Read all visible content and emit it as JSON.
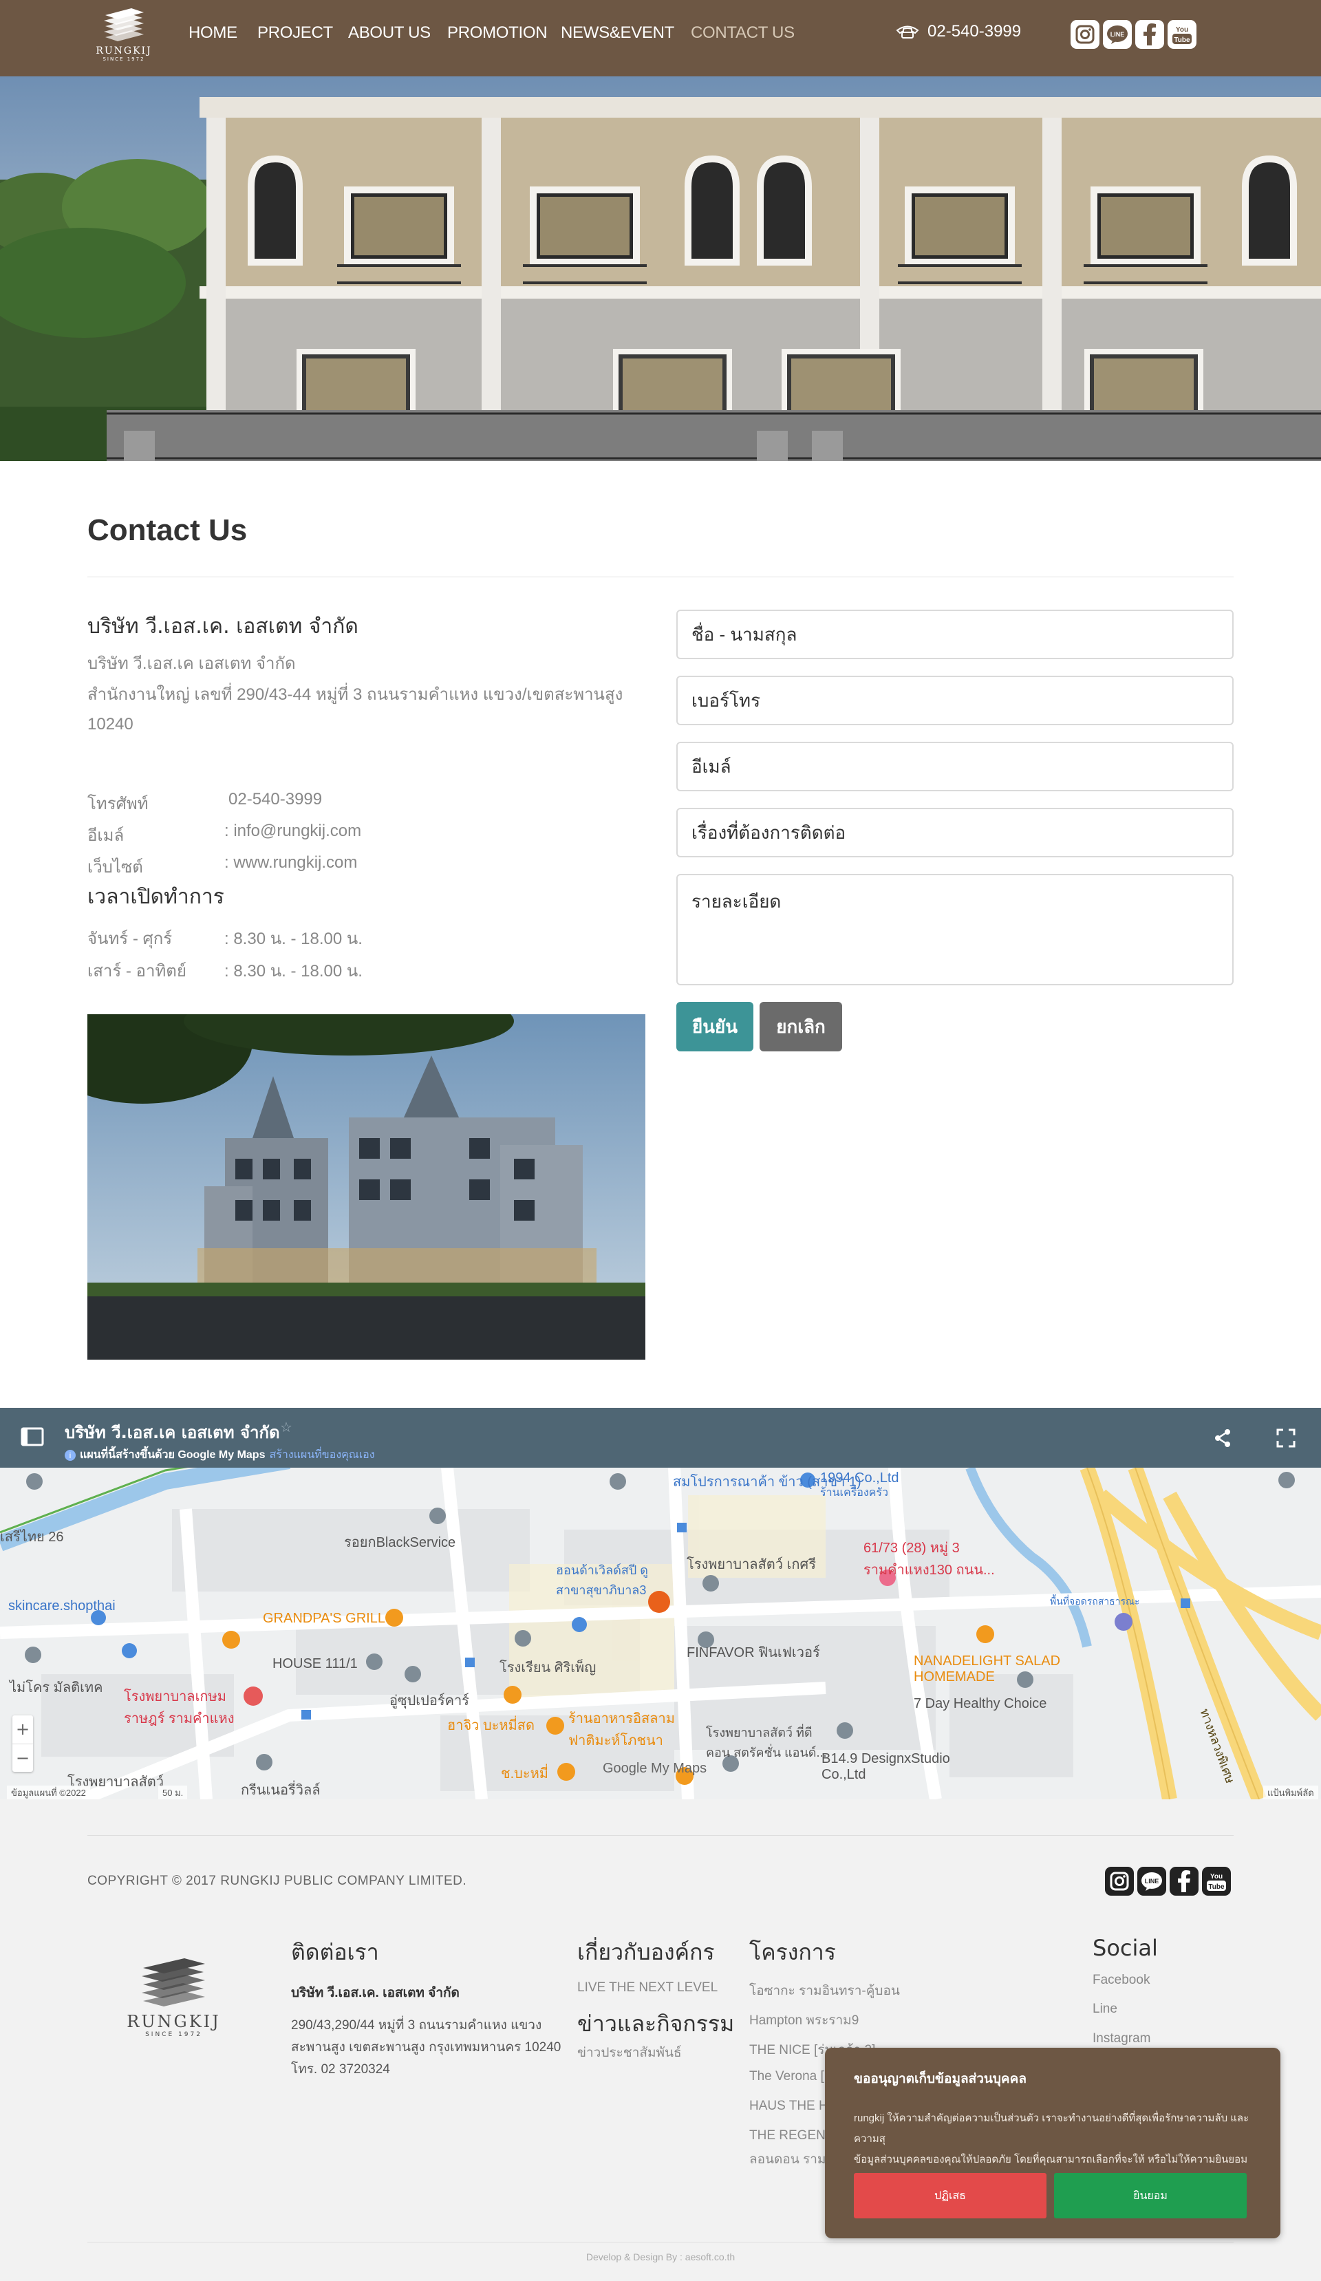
{
  "brand": {
    "name": "RUNGKIJ",
    "since": "SINCE 1972"
  },
  "nav": {
    "items": [
      {
        "label": "HOME"
      },
      {
        "label": "PROJECT"
      },
      {
        "label": "ABOUT US"
      },
      {
        "label": "PROMOTION"
      },
      {
        "label": "NEWS&EVENT"
      },
      {
        "label": "CONTACT US",
        "active": true
      }
    ],
    "phone": "02-540-3999"
  },
  "social": {
    "icons": [
      "instagram-icon",
      "line-icon",
      "facebook-icon",
      "youtube-icon"
    ],
    "youtube_text": "You Tube",
    "line_text": "LINE"
  },
  "contact": {
    "title": "Contact Us",
    "company": "บริษัท วี.เอส.เค. เอสเตท จำกัด",
    "company_sub": "บริษัท วี.เอส.เค เอสเตท จำกัด",
    "address_1": "สำนักงานใหญ่ เลขที่ 290/43-44 หมู่ที่ 3 ถนนรามคำแหง แขวง/เขตสะพานสูง",
    "address_2": "10240",
    "phone_label": "โทรศัพท์",
    "phone_value": "02-540-3999",
    "email_label": "อีเมล์",
    "email_value": ": info@rungkij.com",
    "web_label": "เว็บไซต์",
    "web_value": ": www.rungkij.com",
    "hours_title": "เวลาเปิดทำการ",
    "hours": [
      {
        "day": "จันทร์ - ศุกร์",
        "time": ": 8.30 น. - 18.00 น."
      },
      {
        "day": "เสาร์ - อาทิตย์",
        "time": ": 8.30 น. - 18.00 น."
      }
    ]
  },
  "form": {
    "name_placeholder": "ชื่อ - นามสกุล",
    "phone_placeholder": "เบอร์โทร",
    "email_placeholder": "อีเมล์",
    "subject_placeholder": "เรื่องที่ต้องการติดต่อ",
    "detail_placeholder": "รายละเอียด",
    "submit_label": "ยืนยัน",
    "cancel_label": "ยกเลิก",
    "submit_color": "#3d9497",
    "cancel_color": "#6b6b6b"
  },
  "map": {
    "title": "บริษัท วี.เอส.เค เอสเตท จำกัด",
    "subtitle": "แผนที่นี้สร้างขึ้นด้วย Google My Maps",
    "subtitle_link": "สร้างแผนที่ของคุณเอง",
    "labels": [
      "สมโปรการณาค้า ข้าว (สาขา 1)",
      "1994 Co.,Ltd",
      "ร้านเครื่องครัว",
      "61/73 (28) หมู่ 3 รามคำแหง130 ถนน...",
      "รอยกBlackService",
      "ฮอนด้าเวิลด์สปี ดู สาขาสุขาภิบาล3",
      "โรงพยาบาลสัตว์ เกศรี",
      "skincare.shopthai",
      "GRANDPA'S GRILL",
      "HOUSE 111/1",
      "โรงเรียน ศิริเพ็ญ",
      "FINFAVOR ฟินเฟเวอร์",
      "NANADELIGHT SALAD HOMEMADE",
      "ไม่โคร มัลติเทค",
      "โรงพยาบาลเกษม ราษฎร์ รามคำแหง",
      "อู่ซุปเปอร์คาร์",
      "ฮาจิว บะหมี่สด",
      "ร้านอาหารอิสลาม ฟาติมะห์โภชนา",
      "โรงพยาบาลสัตว์ ที่ดี คอน สตรัคชั่น แอนด์...",
      "7 Day Healthy Choice",
      "B14.9 DesignxStudio Co.,Ltd",
      "ช.บะหมี่",
      "โรงพยาบาลสัตว์",
      "กรีนเนอรี่วิลล์",
      "เสรีไทย 26",
      "พื้นที่จอดรถสาธารณะ",
      "ทางหลวงพิเศษ"
    ],
    "attribution": "ข้อมูลแผนที่ ©2022",
    "scale": "50 ม.",
    "terms": "แป้นพิมพ์ลัด",
    "google_text": "Google My Maps",
    "zoom_in": "+",
    "zoom_out": "−"
  },
  "footer": {
    "copyright": "COPYRIGHT © 2017 RUNGKIJ PUBLIC COMPANY LIMITED.",
    "contact_title": "ติดต่อเรา",
    "contact_company": "บริษัท วี.เอส.เค. เอสเตท จำกัด",
    "contact_addr_1": "290/43,290/44 หมู่ที่ 3 ถนนรามคำแหง แขวง",
    "contact_addr_2": "สะพานสูง เขตสะพานสูง กรุงเทพมหานคร 10240",
    "contact_tel": "โทร. 02 3720324",
    "about_title": "เกี่ยวกับองค์กร",
    "about_link": "LIVE THE NEXT LEVEL",
    "news_title": "ข่าวและกิจกรรม",
    "news_link": "ข่าวประชาสัมพันธ์",
    "projects_title": "โครงการ",
    "projects": [
      "โอซากะ รามอินทรา-คู้บอน",
      "Hampton พระราม9",
      "THE NICE [ร่มเกล้า 2]",
      "The Verona [",
      "HAUS THE H",
      "THE REGENT",
      "ลอนดอน รามอิ"
    ],
    "social_title": "Social",
    "social_links": [
      "Facebook",
      "Line",
      "Instagram"
    ],
    "dev": "Develop & Design By : aesoft.co.th"
  },
  "cookie": {
    "title": "ขออนุญาตเก็บข้อมูลส่วนบุคคล",
    "body_1": "rungkij ให้ความสำคัญต่อความเป็นส่วนตัว เราจะทำงานอย่างดีที่สุดเพื่อรักษาความลับ และความสุ",
    "body_2": "ข้อมูลส่วนบุคคลของคุณให้ปลอดภัย โดยที่คุณสามารถเลือกที่จะให้ หรือไม่ให้ความยินยอมก็ได้",
    "reject_label": "ปฏิเสธ",
    "accept_label": "ยินยอม",
    "reject_color": "#e34a4a",
    "accept_color": "#1f9e50"
  }
}
